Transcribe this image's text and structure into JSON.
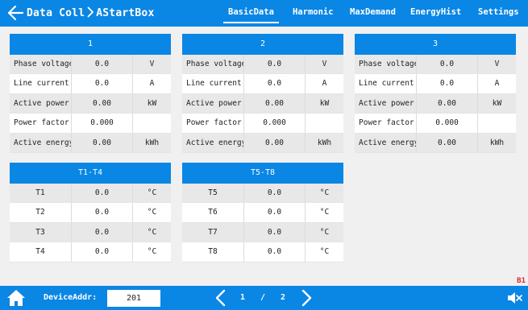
{
  "header": {
    "title_part1": "Data Coll",
    "title_part2": "AStartBox",
    "tabs": [
      {
        "label": "BasicData",
        "active": true
      },
      {
        "label": "Harmonic",
        "active": false
      },
      {
        "label": "MaxDemand",
        "active": false
      },
      {
        "label": "EnergyHist",
        "active": false
      },
      {
        "label": "Settings",
        "active": false
      }
    ]
  },
  "phases": [
    {
      "title": "1",
      "rows": [
        {
          "label": "Phase voltage",
          "value": "0.0",
          "unit": "V"
        },
        {
          "label": "Line current",
          "value": "0.0",
          "unit": "A"
        },
        {
          "label": "Active power",
          "value": "0.00",
          "unit": "kW"
        },
        {
          "label": "Power factor",
          "value": "0.000",
          "unit": ""
        },
        {
          "label": "Active energy",
          "value": "0.00",
          "unit": "kWh"
        }
      ]
    },
    {
      "title": "2",
      "rows": [
        {
          "label": "Phase voltage",
          "value": "0.0",
          "unit": "V"
        },
        {
          "label": "Line current",
          "value": "0.0",
          "unit": "A"
        },
        {
          "label": "Active power",
          "value": "0.00",
          "unit": "kW"
        },
        {
          "label": "Power factor",
          "value": "0.000",
          "unit": ""
        },
        {
          "label": "Active energy",
          "value": "0.00",
          "unit": "kWh"
        }
      ]
    },
    {
      "title": "3",
      "rows": [
        {
          "label": "Phase voltage",
          "value": "0.0",
          "unit": "V"
        },
        {
          "label": "Line current",
          "value": "0.0",
          "unit": "A"
        },
        {
          "label": "Active power",
          "value": "0.00",
          "unit": "kW"
        },
        {
          "label": "Power factor",
          "value": "0.000",
          "unit": ""
        },
        {
          "label": "Active energy",
          "value": "0.00",
          "unit": "kWh"
        }
      ]
    }
  ],
  "temps": [
    {
      "title": "T1-T4",
      "rows": [
        {
          "label": "T1",
          "value": "0.0",
          "unit": "°C"
        },
        {
          "label": "T2",
          "value": "0.0",
          "unit": "°C"
        },
        {
          "label": "T3",
          "value": "0.0",
          "unit": "°C"
        },
        {
          "label": "T4",
          "value": "0.0",
          "unit": "°C"
        }
      ]
    },
    {
      "title": "T5-T8",
      "rows": [
        {
          "label": "T5",
          "value": "0.0",
          "unit": "°C"
        },
        {
          "label": "T6",
          "value": "0.0",
          "unit": "°C"
        },
        {
          "label": "T7",
          "value": "0.0",
          "unit": "°C"
        },
        {
          "label": "T8",
          "value": "0.0",
          "unit": "°C"
        }
      ]
    }
  ],
  "status_marker": "B1",
  "footer": {
    "device_addr_label": "DeviceAddr:",
    "device_addr_value": "201",
    "page_current": "1",
    "page_separator": "/",
    "page_total": "2"
  },
  "icons": {
    "back": "back-arrow-icon",
    "breadcrumb": "chevron-right-icon",
    "home": "home-icon",
    "prev": "chevron-left-icon",
    "next": "chevron-right-icon",
    "sound": "mute-icon"
  },
  "colors": {
    "accent": "#0a86e4",
    "row_alt": "#e8e8e8",
    "background": "#f0f0f0",
    "alert": "#e0262c"
  }
}
